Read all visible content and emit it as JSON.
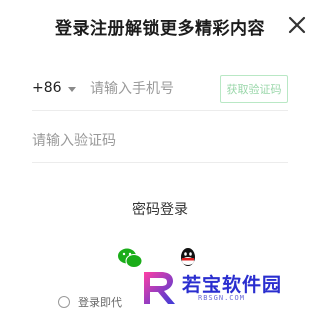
{
  "header": {
    "title": "登录注册解锁更多精彩内容",
    "close_icon": "close-icon"
  },
  "phone_form": {
    "country_code": "+86",
    "phone_placeholder": "请输入手机号",
    "get_code_label": "获取验证码",
    "code_placeholder": "请输入验证码"
  },
  "password_login_label": "密码登录",
  "social_login": {
    "icons": [
      "wechat-icon",
      "qq-icon"
    ]
  },
  "agreement": {
    "text": "登录即代"
  },
  "watermark": {
    "text": "若宝软件园",
    "subtext": "RBSGN.COM"
  },
  "colors": {
    "accent_green": "#1aad19",
    "get_code_border": "#b9e8c5",
    "watermark_blue": "#2a2ecf"
  }
}
